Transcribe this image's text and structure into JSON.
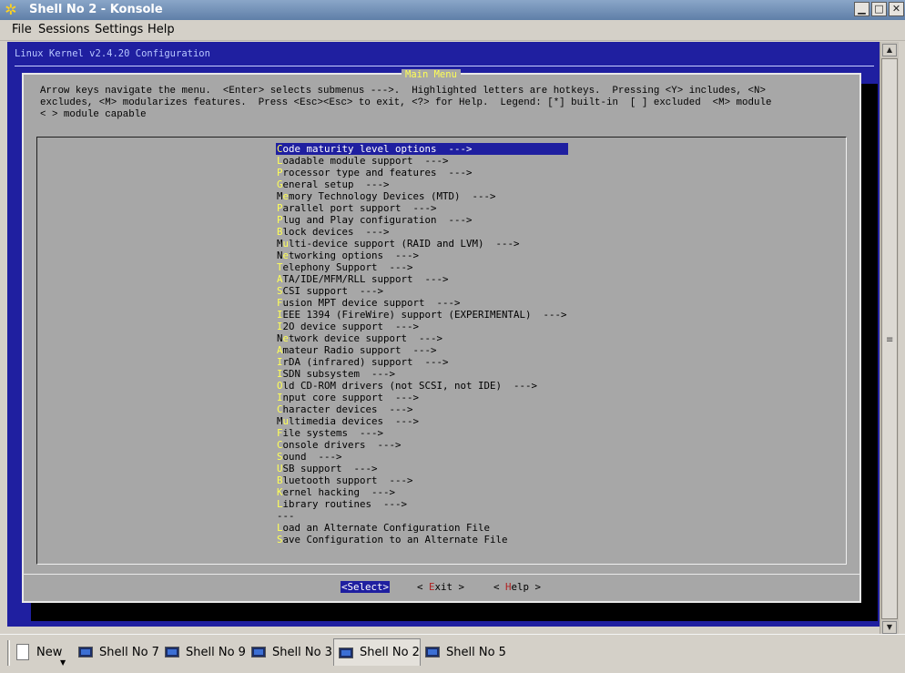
{
  "window": {
    "title": "Shell No 2 - Konsole",
    "app_icon": "konsole-gear-icon",
    "controls": [
      "minimize-icon",
      "maximize-icon",
      "close-icon"
    ]
  },
  "menubar": {
    "file": "File",
    "sessions": "Sessions",
    "settings": "Settings",
    "help": "Help"
  },
  "terminal": {
    "header_title": "Linux Kernel v2.4.20 Configuration",
    "dialog_title": "Main Menu",
    "help_lines": [
      "Arrow keys navigate the menu.  <Enter> selects submenus --->.  Highlighted letters are hotkeys.  Pressing <Y> includes, <N>",
      "excludes, <M> modularizes features.  Press <Esc><Esc> to exit, <?> for Help.  Legend: [*] built-in  [ ] excluded  <M> module",
      "< > module capable"
    ],
    "menu_items": [
      {
        "hotkey": "C",
        "rest": "ode maturity level options  --->",
        "selected": true
      },
      {
        "hotkey": "L",
        "rest": "oadable module support  --->"
      },
      {
        "hotkey": "P",
        "rest": "rocessor type and features  --->"
      },
      {
        "hotkey": "G",
        "rest": "eneral setup  --->"
      },
      {
        "pre": "M",
        "hotkey": "e",
        "rest": "mory Technology Devices (MTD)  --->"
      },
      {
        "hotkey": "P",
        "rest": "arallel port support  --->"
      },
      {
        "hotkey": "P",
        "rest": "lug and Play configuration  --->"
      },
      {
        "hotkey": "B",
        "rest": "lock devices  --->"
      },
      {
        "pre": "M",
        "hotkey": "u",
        "rest": "lti-device support (RAID and LVM)  --->"
      },
      {
        "pre": "N",
        "hotkey": "e",
        "rest": "tworking options  --->"
      },
      {
        "hotkey": "T",
        "rest": "elephony Support  --->"
      },
      {
        "hotkey": "A",
        "rest": "TA/IDE/MFM/RLL support  --->"
      },
      {
        "hotkey": "S",
        "rest": "CSI support  --->"
      },
      {
        "hotkey": "F",
        "rest": "usion MPT device support  --->"
      },
      {
        "hotkey": "I",
        "rest": "EEE 1394 (FireWire) support (EXPERIMENTAL)  --->"
      },
      {
        "hotkey": "I",
        "rest": "2O device support  --->"
      },
      {
        "pre": "N",
        "hotkey": "e",
        "rest": "twork device support  --->"
      },
      {
        "hotkey": "A",
        "rest": "mateur Radio support  --->"
      },
      {
        "hotkey": "I",
        "rest": "rDA (infrared) support  --->"
      },
      {
        "hotkey": "I",
        "rest": "SDN subsystem  --->"
      },
      {
        "hotkey": "O",
        "rest": "ld CD-ROM drivers (not SCSI, not IDE)  --->"
      },
      {
        "hotkey": "I",
        "rest": "nput core support  --->"
      },
      {
        "hotkey": "C",
        "rest": "haracter devices  --->"
      },
      {
        "pre": "M",
        "hotkey": "u",
        "rest": "ltimedia devices  --->"
      },
      {
        "hotkey": "F",
        "rest": "ile systems  --->"
      },
      {
        "hotkey": "C",
        "rest": "onsole drivers  --->"
      },
      {
        "hotkey": "S",
        "rest": "ound  --->"
      },
      {
        "hotkey": "U",
        "rest": "SB support  --->"
      },
      {
        "hotkey": "B",
        "rest": "luetooth support  --->"
      },
      {
        "hotkey": "K",
        "rest": "ernel hacking  --->"
      },
      {
        "hotkey": "L",
        "rest": "ibrary routines  --->"
      },
      {
        "rest": "---"
      },
      {
        "hotkey": "L",
        "rest": "oad an Alternate Configuration File"
      },
      {
        "hotkey": "S",
        "rest": "ave Configuration to an Alternate File"
      }
    ],
    "buttons": {
      "select": "<Select>",
      "exit_open": "< ",
      "exit_hotkey": "E",
      "exit_rest": "xit",
      "exit_close": " >",
      "help_open": "< ",
      "help_hotkey": "H",
      "help_rest": "elp",
      "help_close": " >"
    }
  },
  "taskbar": {
    "new_label": "New",
    "tabs": [
      {
        "label": "Shell No 7"
      },
      {
        "label": "Shell No 9"
      },
      {
        "label": "Shell No 3"
      },
      {
        "label": "Shell No 2",
        "active": true
      },
      {
        "label": "Shell No 5"
      }
    ]
  },
  "colors": {
    "terminal_bg": "#1f1fa0",
    "dialog_bg": "#a7a7a7",
    "hotkey": "#ffff55",
    "title_bar": "#6f8fb8"
  }
}
